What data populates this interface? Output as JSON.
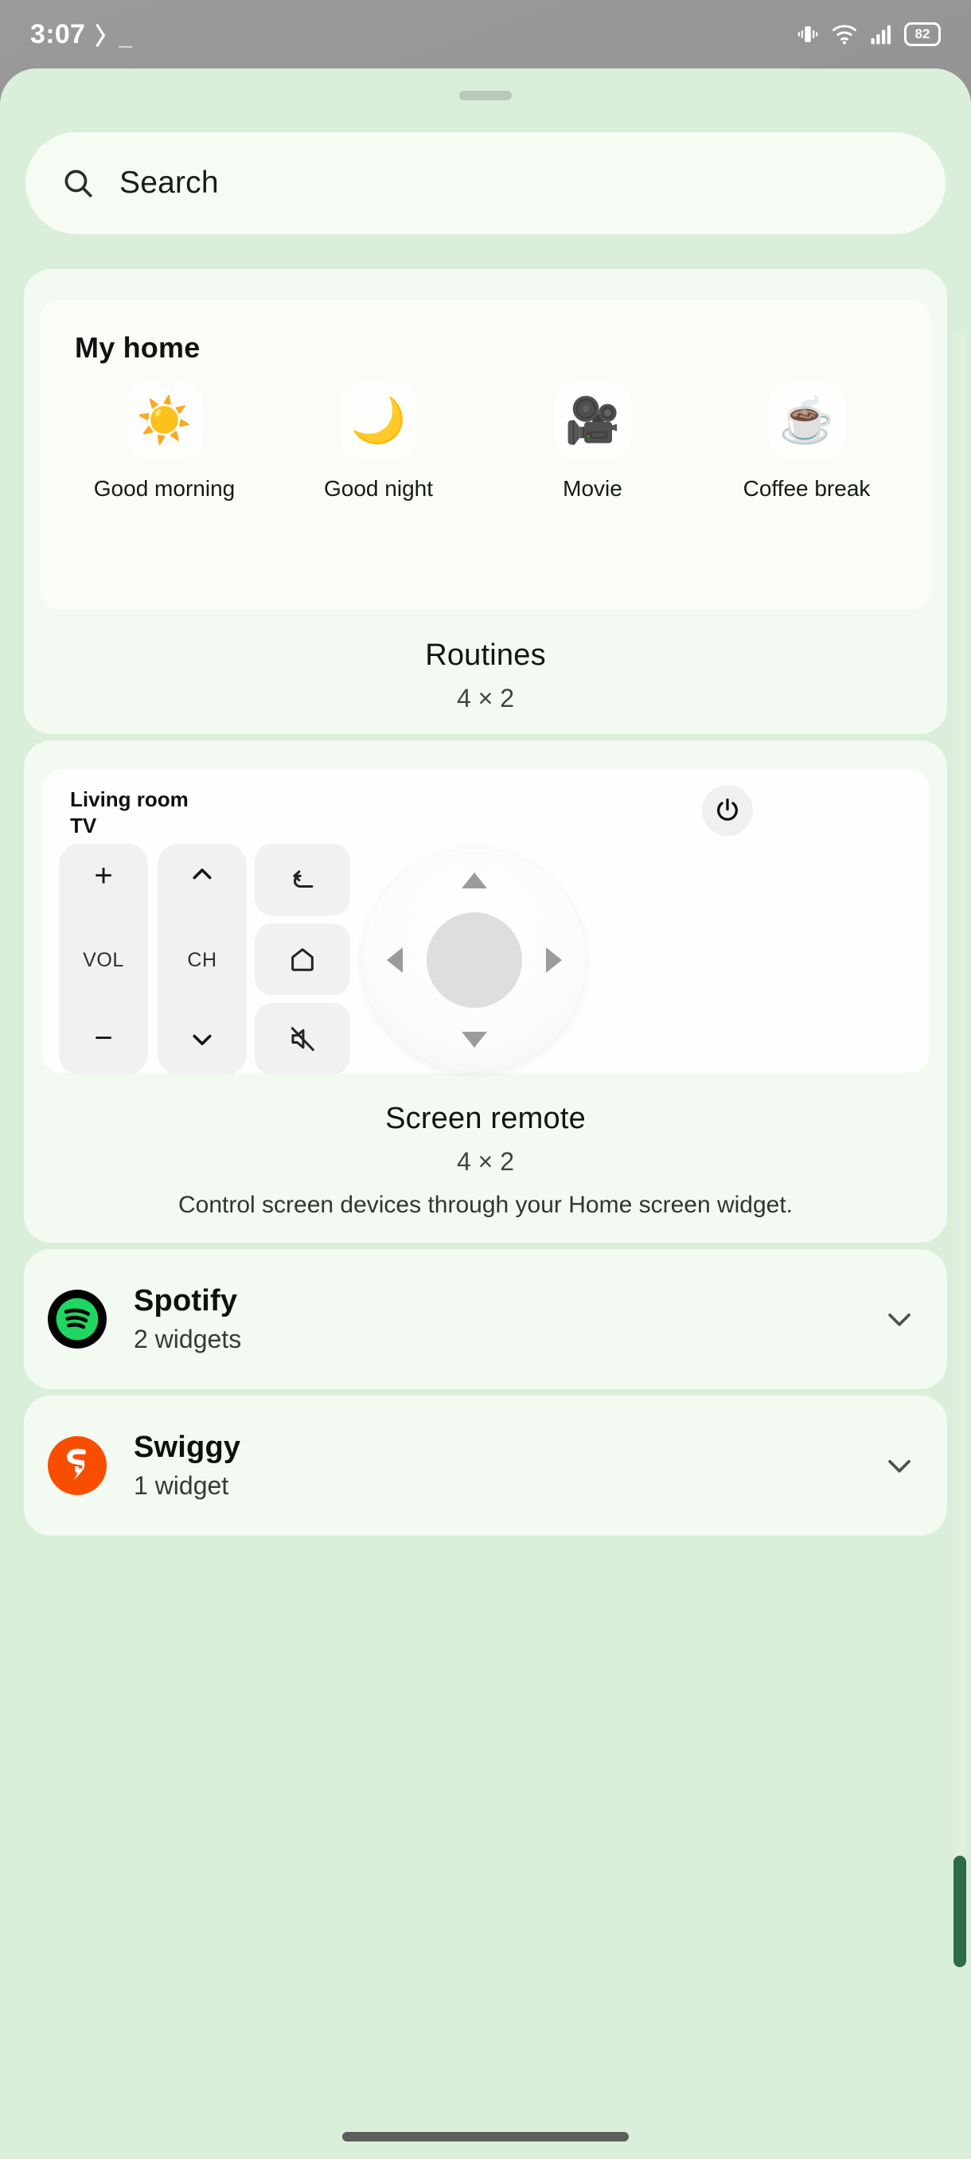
{
  "status_bar": {
    "clock": "3:07",
    "terminal_glyph": "〉_",
    "icons": [
      "vibrate-icon",
      "wifi-icon",
      "cellular-signal-icon"
    ],
    "battery_level": "82"
  },
  "search": {
    "placeholder": "Search",
    "icon": "search-icon"
  },
  "widgets": [
    {
      "preview_title": "My home",
      "name": "Routines",
      "size": "4 × 2",
      "description": "",
      "routines": [
        {
          "emoji": "☀️",
          "label": "Good morning",
          "icon": "sun-icon"
        },
        {
          "emoji": "🌙",
          "label": "Good night",
          "icon": "moon-icon"
        },
        {
          "emoji": "🎥",
          "label": "Movie",
          "icon": "movie-camera-icon"
        },
        {
          "emoji": "☕",
          "label": "Coffee break",
          "icon": "coffee-cup-icon"
        }
      ]
    },
    {
      "name": "Screen remote",
      "size": "4 × 2",
      "description": "Control screen devices through your Home screen widget.",
      "remote": {
        "room": "Living room",
        "device": "TV",
        "power_icon": "power-icon",
        "vol_label": "VOL",
        "vol_up": "+",
        "vol_down": "−",
        "ch_label": "CH",
        "ch_up": "chevron-up-icon",
        "ch_down": "chevron-down-icon",
        "back_icon": "back-arrow-icon",
        "home_icon": "home-icon",
        "mute_icon": "mute-icon",
        "dpad": [
          "up",
          "left",
          "right",
          "down",
          "select"
        ]
      }
    }
  ],
  "app_groups": [
    {
      "name": "Spotify",
      "count": "2 widgets",
      "icon": "spotify-logo",
      "icon_bg": "#000000",
      "icon_fg": "#1ed760",
      "expand_icon": "chevron-down-icon"
    },
    {
      "name": "Swiggy",
      "count": "1 widget",
      "icon": "swiggy-logo",
      "icon_bg": "#f94e00",
      "icon_fg": "#ffffff",
      "expand_icon": "chevron-down-icon"
    }
  ],
  "colors": {
    "sheet_bg": "#daefda",
    "panel_bg": "#f3faf1",
    "card_bg": "#f9fcf7",
    "search_bg": "#f6fbf4",
    "scrollbar_thumb": "#2d6b49",
    "spotify_green": "#1ed760",
    "swiggy_orange": "#f94e00"
  }
}
